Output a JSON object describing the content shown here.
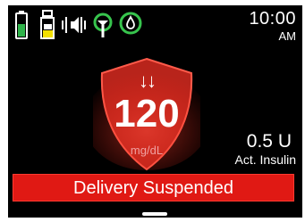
{
  "status_bar": {
    "icons": [
      {
        "name": "battery-icon",
        "color": "#2fb34a"
      },
      {
        "name": "insulin-reservoir-icon",
        "color": "#f3e000"
      },
      {
        "name": "audio-vibrate-icon",
        "color": "#ffffff"
      },
      {
        "name": "cgm-connection-icon",
        "color": "#37c44d"
      },
      {
        "name": "sensor-drop-icon",
        "color": "#37c44d"
      }
    ],
    "time": "10:00",
    "ampm": "AM"
  },
  "glucose": {
    "trend_arrows": "↓↓",
    "value": "120",
    "unit": "mg/dL",
    "shield_color": "#b8241b"
  },
  "insulin": {
    "value": "0.5 U",
    "label": "Act. Insulin"
  },
  "banner": {
    "text": "Delivery Suspended",
    "color": "#e01914"
  }
}
